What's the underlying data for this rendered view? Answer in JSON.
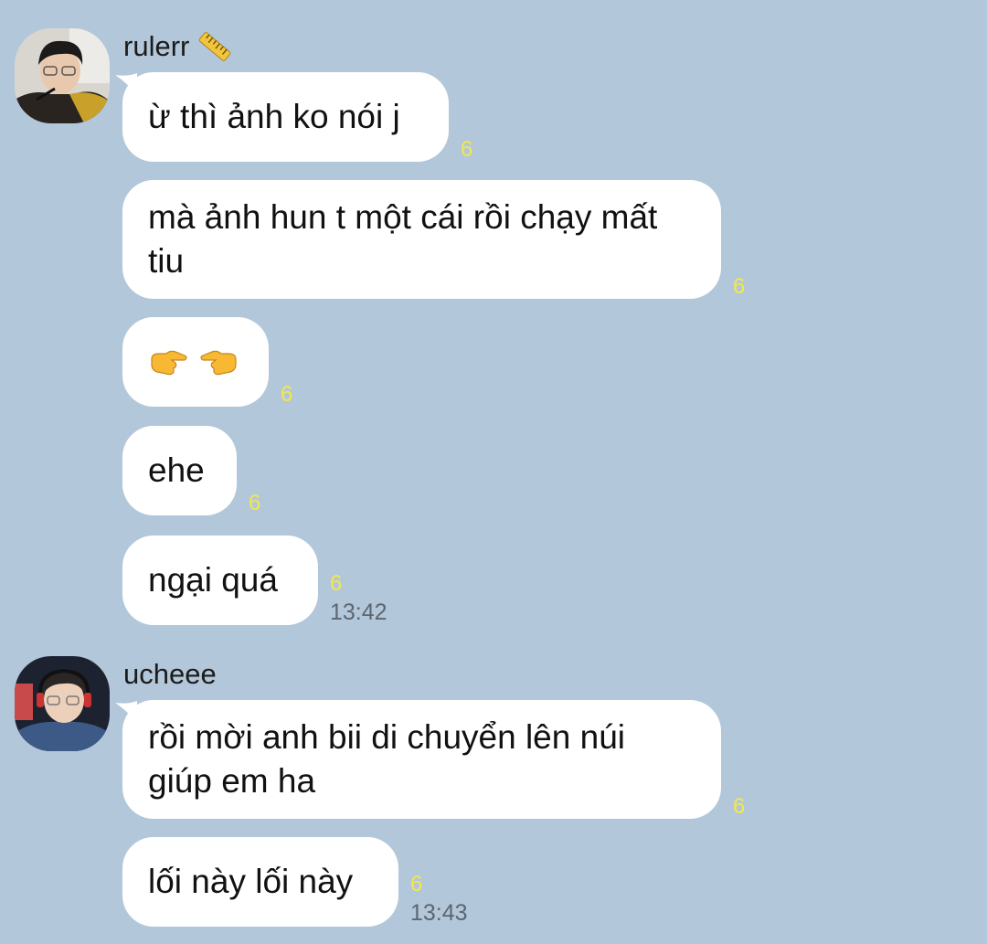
{
  "colors": {
    "background": "#b2c7da",
    "bubble": "#ffffff",
    "unread": "#f5e74a",
    "time": "#5d6670"
  },
  "groups": [
    {
      "sender": "rulerr",
      "sender_badge_icon": "ruler-icon",
      "avatar_icon": "person-avatar",
      "messages": [
        {
          "text": "ừ thì ảnh ko nói j",
          "unread": "6"
        },
        {
          "text": "mà ảnh hun t một cái rồi chạy mất tiu",
          "unread": "6"
        },
        {
          "text": "",
          "icons": [
            "pointing-right-icon",
            "pointing-left-icon"
          ],
          "unread": "6"
        },
        {
          "text": "ehe",
          "unread": "6"
        },
        {
          "text": "ngại quá",
          "unread": "6",
          "time": "13:42"
        }
      ]
    },
    {
      "sender": "ucheee",
      "avatar_icon": "person-avatar",
      "messages": [
        {
          "text": "rồi mời anh bii di chuyển lên núi giúp em ha",
          "unread": "6"
        },
        {
          "text": "lối này lối này",
          "unread": "6",
          "time": "13:43"
        }
      ]
    }
  ]
}
